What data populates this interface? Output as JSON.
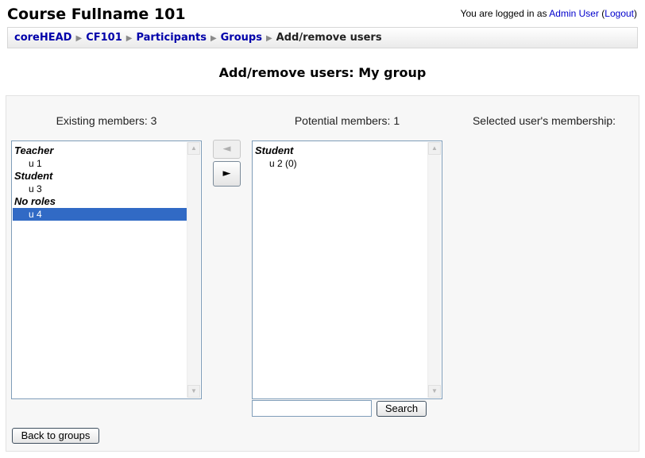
{
  "header": {
    "course_title": "Course Fullname 101",
    "login_prefix": "You are logged in as ",
    "user_name": "Admin User",
    "logout_open": " (",
    "logout_label": "Logout",
    "logout_close": ")"
  },
  "breadcrumb": {
    "items": [
      "coreHEAD",
      "CF101",
      "Participants",
      "Groups"
    ],
    "current": "Add/remove users",
    "separator": "▶"
  },
  "page": {
    "heading": "Add/remove users: My group"
  },
  "existing": {
    "label": "Existing members: 3",
    "groups": [
      {
        "name": "Teacher",
        "members": [
          "u 1"
        ]
      },
      {
        "name": "Student",
        "members": [
          "u 3"
        ]
      },
      {
        "name": "No roles",
        "members": [
          "u 4"
        ]
      }
    ],
    "selected": "u 4"
  },
  "potential": {
    "label": "Potential members: 1",
    "groups": [
      {
        "name": "Student",
        "members": [
          "u 2 (0)"
        ]
      }
    ]
  },
  "membership": {
    "label": "Selected user's membership:"
  },
  "controls": {
    "add_arrow": "◄",
    "remove_arrow": "►",
    "search_value": "",
    "search_label": "Search",
    "back_label": "Back to groups"
  }
}
